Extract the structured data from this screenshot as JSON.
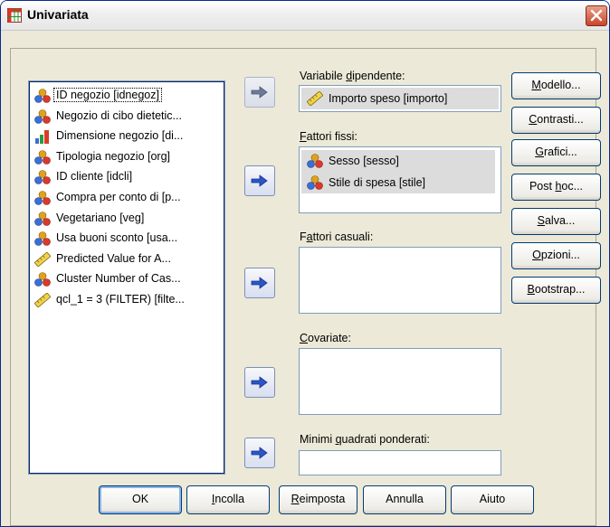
{
  "window": {
    "title": "Univariata",
    "icon": "grid-table-icon",
    "close_icon": "close-x-icon"
  },
  "variable_list": {
    "items": [
      {
        "label": "ID negozio [idnegoz]",
        "icon": "nominal-icon",
        "selected": true
      },
      {
        "label": "Negozio di cibo dietetic...",
        "icon": "nominal-icon"
      },
      {
        "label": "Dimensione negozio [di...",
        "icon": "ordinal-icon"
      },
      {
        "label": "Tipologia negozio [org]",
        "icon": "nominal-icon"
      },
      {
        "label": "ID cliente [idcli]",
        "icon": "nominal-icon"
      },
      {
        "label": "Compra per conto di [p...",
        "icon": "nominal-icon"
      },
      {
        "label": "Vegetariano [veg]",
        "icon": "nominal-icon"
      },
      {
        "label": "Usa buoni sconto [usa...",
        "icon": "nominal-icon"
      },
      {
        "label": "Predicted Value for A...",
        "icon": "scale-ruler-icon"
      },
      {
        "label": "Cluster Number of Cas...",
        "icon": "nominal-icon"
      },
      {
        "label": "qcl_1 = 3 (FILTER) [filte...",
        "icon": "scale-ruler-icon"
      }
    ]
  },
  "dependent": {
    "label_pre": "Variabile ",
    "label_u": "d",
    "label_post": "ipendente:",
    "value": "Importo speso [importo]",
    "icon": "scale-ruler-icon"
  },
  "fixed_factors": {
    "label_pre": "",
    "label_u": "F",
    "label_post": "attori fissi:",
    "items": [
      {
        "label": "Sesso [sesso]",
        "icon": "nominal-icon"
      },
      {
        "label": "Stile di spesa [stile]",
        "icon": "nominal-icon"
      }
    ]
  },
  "random_factors": {
    "label_pre": "F",
    "label_u": "a",
    "label_post": "ttori casuali:"
  },
  "covariates": {
    "label_pre": "",
    "label_u": "C",
    "label_post": "ovariate:"
  },
  "wls": {
    "label_pre": "Minimi ",
    "label_u": "q",
    "label_post": "uadrati ponderati:"
  },
  "side_buttons": [
    {
      "pre": "",
      "u": "M",
      "post": "odello..."
    },
    {
      "pre": "",
      "u": "C",
      "post": "ontrasti..."
    },
    {
      "pre": "",
      "u": "G",
      "post": "rafici..."
    },
    {
      "pre": "Post ",
      "u": "h",
      "post": "oc..."
    },
    {
      "pre": "",
      "u": "S",
      "post": "alva..."
    },
    {
      "pre": "",
      "u": "O",
      "post": "pzioni..."
    },
    {
      "pre": "",
      "u": "B",
      "post": "ootstrap..."
    }
  ],
  "bottom_buttons": [
    {
      "pre": "OK",
      "u": "",
      "post": ""
    },
    {
      "pre": "",
      "u": "I",
      "post": "ncolla"
    },
    {
      "pre": "",
      "u": "R",
      "post": "eimposta"
    },
    {
      "pre": "Annulla",
      "u": "",
      "post": ""
    },
    {
      "pre": "Aiuto",
      "u": "",
      "post": ""
    }
  ],
  "arrow_icon": "right-arrow-icon"
}
